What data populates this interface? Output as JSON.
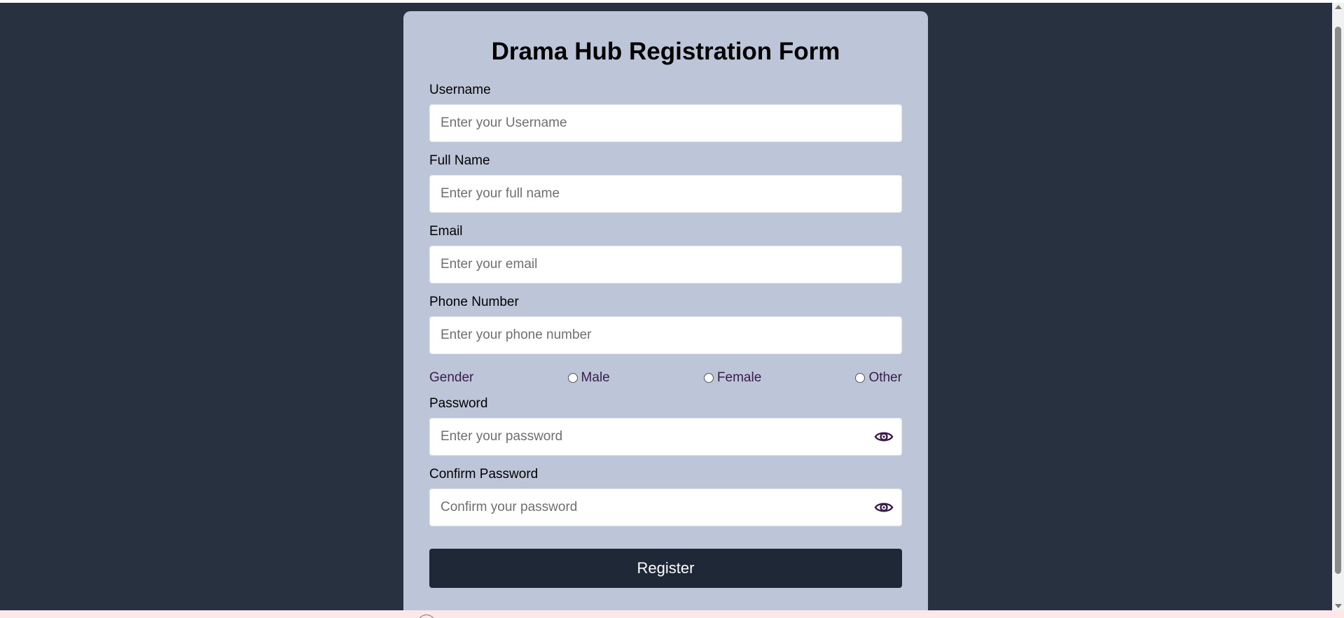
{
  "form": {
    "title": "Drama Hub Registration Form",
    "fields": {
      "username": {
        "label": "Username",
        "placeholder": "Enter your Username",
        "value": ""
      },
      "fullname": {
        "label": "Full Name",
        "placeholder": "Enter your full name",
        "value": ""
      },
      "email": {
        "label": "Email",
        "placeholder": "Enter your email",
        "value": ""
      },
      "phone": {
        "label": "Phone Number",
        "placeholder": "Enter your phone number",
        "value": ""
      },
      "password": {
        "label": "Password",
        "placeholder": "Enter your password",
        "value": ""
      },
      "confirm": {
        "label": "Confirm Password",
        "placeholder": "Confirm your password",
        "value": ""
      }
    },
    "gender": {
      "label": "Gender",
      "options": [
        "Male",
        "Female",
        "Other"
      ],
      "selected": null
    },
    "register_label": "Register",
    "icons": {
      "password_toggle": "eye-icon",
      "confirm_toggle": "eye-icon"
    }
  },
  "colors": {
    "page_background": "#27313f",
    "card_background": "#bdc6d8",
    "button_background": "#1f2837",
    "gender_text": "#3a1b4a",
    "eye_icon": "#3a1b4a"
  }
}
